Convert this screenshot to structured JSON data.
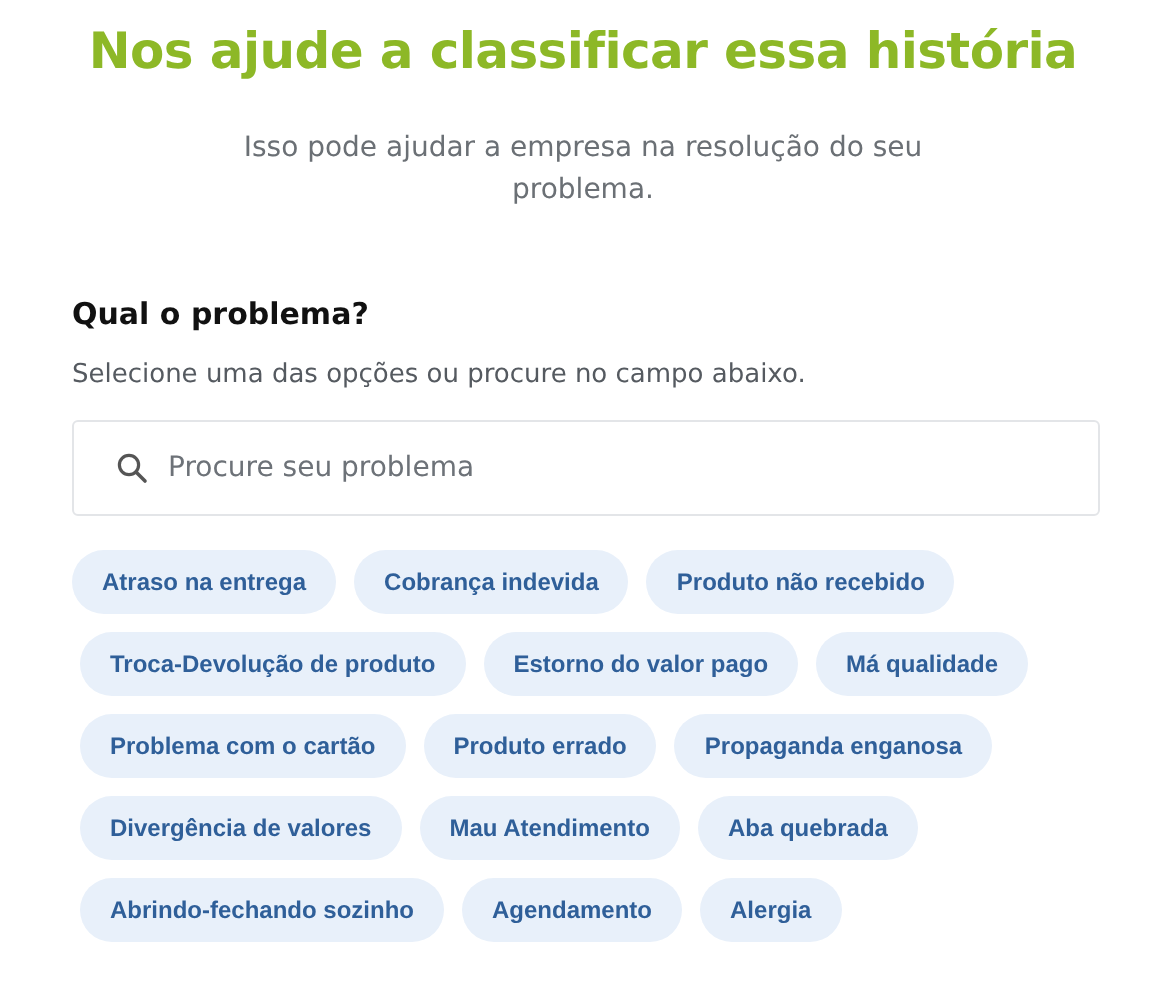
{
  "title": "Nos ajude a classificar essa história",
  "subtitle": "Isso pode ajudar a empresa na resolução do seu problema.",
  "question": "Qual o problema?",
  "instruction": "Selecione uma das opções ou procure no campo abaixo.",
  "search": {
    "placeholder": "Procure seu problema"
  },
  "chip_rows": [
    [
      "Atraso na entrega",
      "Cobrança indevida",
      "Produto não recebido"
    ],
    [
      "Troca-Devolução de produto",
      "Estorno do valor pago",
      "Má qualidade"
    ],
    [
      "Problema com o cartão",
      "Produto errado",
      "Propaganda enganosa"
    ],
    [
      "Divergência de valores",
      "Mau Atendimento",
      "Aba quebrada"
    ],
    [
      "Abrindo-fechando sozinho",
      "Agendamento",
      "Alergia"
    ]
  ]
}
